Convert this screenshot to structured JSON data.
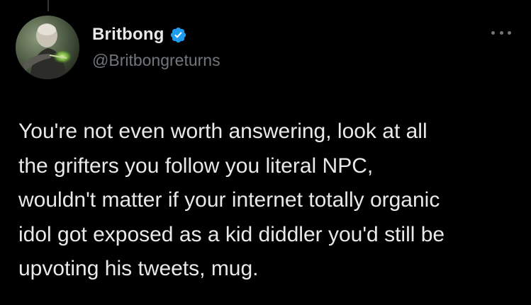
{
  "tweet": {
    "author": {
      "display_name": "Britbong",
      "handle": "@Britbongreturns",
      "verified": true,
      "avatar_icon": "profile-photo"
    },
    "more_icon": "ellipsis-icon",
    "text_lines": [
      "You're not even worth answering, look at all",
      "the grifters you follow you literal NPC,",
      "wouldn't matter if your internet totally organic",
      "idol got exposed as a kid diddler you'd still be",
      "upvoting his tweets, mug."
    ]
  },
  "colors": {
    "background": "#000000",
    "primary_text": "#e7e9ea",
    "secondary_text": "#71767b",
    "verified_blue": "#1d9bf0"
  }
}
